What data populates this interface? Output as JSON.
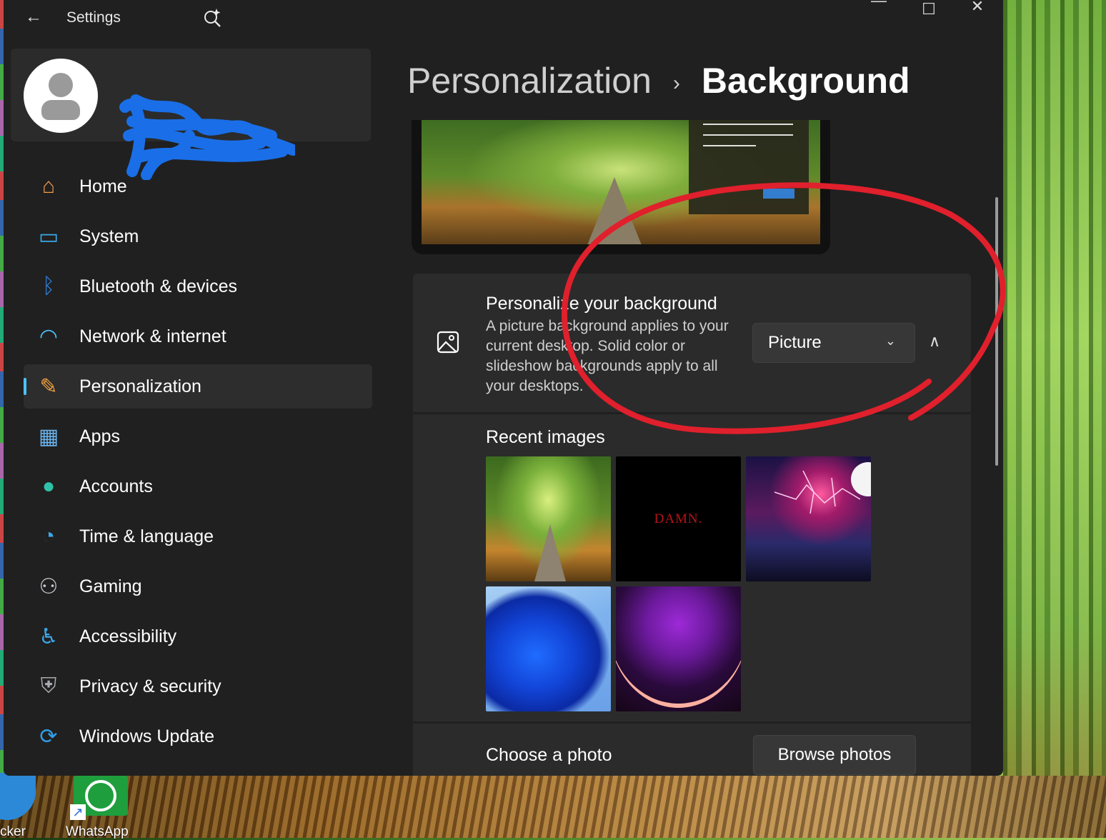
{
  "window": {
    "title": "Settings",
    "back_glyph": "←",
    "minimize_glyph": "—",
    "maximize_glyph": "☐",
    "close_glyph": "✕"
  },
  "desktop": {
    "icons": [
      {
        "label": "cker",
        "icon": "docker-icon"
      },
      {
        "label": "WhatsApp",
        "icon": "whatsapp-icon"
      }
    ]
  },
  "breadcrumb": {
    "parent": "Personalization",
    "separator": "›",
    "current": "Background"
  },
  "sidebar": {
    "items": [
      {
        "label": "Home",
        "icon": "home-icon",
        "glyph": "⌂",
        "color": "#f29c4a"
      },
      {
        "label": "System",
        "icon": "system-icon",
        "glyph": "▭",
        "color": "#3aa8e8"
      },
      {
        "label": "Bluetooth & devices",
        "icon": "bluetooth-icon",
        "glyph": "ᛒ",
        "color": "#2f7ed8"
      },
      {
        "label": "Network & internet",
        "icon": "wifi-icon",
        "glyph": "◠",
        "color": "#4cc2ff"
      },
      {
        "label": "Personalization",
        "icon": "brush-icon",
        "glyph": "✎",
        "color": "#f0a040",
        "selected": true
      },
      {
        "label": "Apps",
        "icon": "apps-icon",
        "glyph": "▦",
        "color": "#6ab0e8"
      },
      {
        "label": "Accounts",
        "icon": "accounts-icon",
        "glyph": "●",
        "color": "#2fc2a8"
      },
      {
        "label": "Time & language",
        "icon": "globe-clock-icon",
        "glyph": "◔",
        "color": "#3aa8e8"
      },
      {
        "label": "Gaming",
        "icon": "gamepad-icon",
        "glyph": "⚇",
        "color": "#c8c8d0"
      },
      {
        "label": "Accessibility",
        "icon": "accessibility-icon",
        "glyph": "♿",
        "color": "#3aa8e8"
      },
      {
        "label": "Privacy & security",
        "icon": "shield-icon",
        "glyph": "⛨",
        "color": "#a8aab0"
      },
      {
        "label": "Windows Update",
        "icon": "update-icon",
        "glyph": "⟳",
        "color": "#2f9ee8"
      }
    ]
  },
  "personalize": {
    "title": "Personalize your background",
    "description": "A picture background applies to your current desktop. Solid color or slideshow backgrounds apply to all your desktops.",
    "dropdown_value": "Picture",
    "dropdown_chevron": "⌄",
    "collapse_glyph": "∧"
  },
  "recent": {
    "title": "Recent images",
    "thumb2_text": "DAMN."
  },
  "choose": {
    "label": "Choose a photo",
    "button": "Browse photos"
  },
  "colors": {
    "window_bg": "#202020",
    "card_bg": "#2b2b2b",
    "accent": "#4cc2ff",
    "annotation": "#e0202c"
  }
}
